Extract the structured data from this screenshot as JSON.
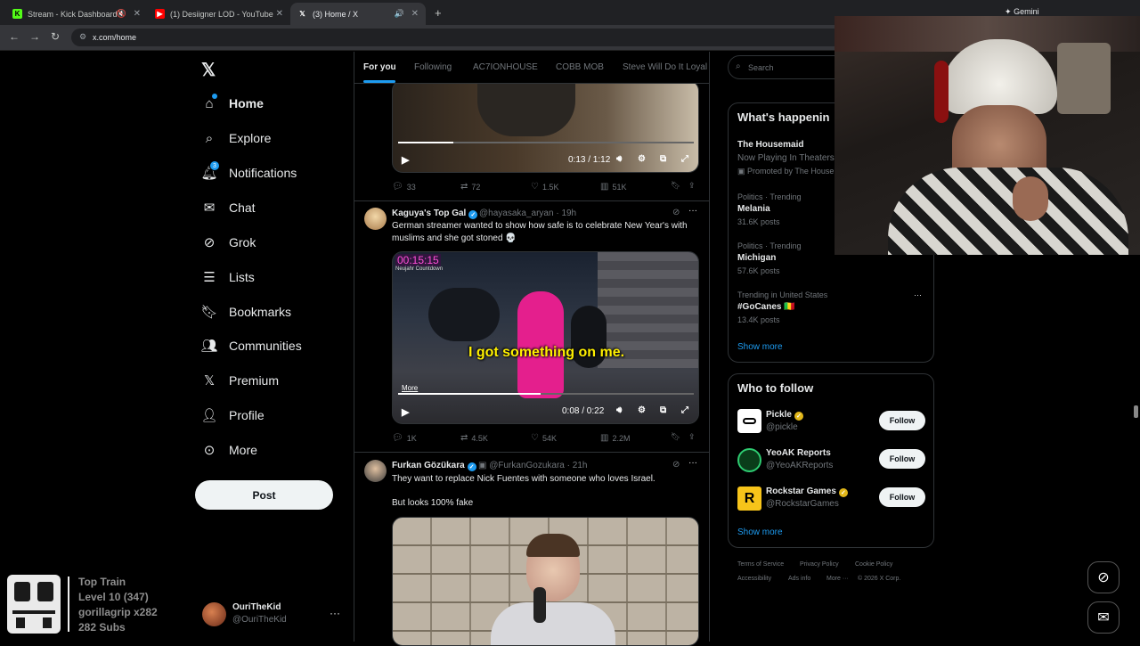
{
  "browser": {
    "tabs": [
      {
        "title": "Stream - Kick Dashboard",
        "icon": "kick-icon",
        "muted": true
      },
      {
        "title": "(1) Desiigner LOD - YouTube",
        "icon": "youtube-icon"
      },
      {
        "title": "(3) Home / X",
        "icon": "x-icon",
        "active": true
      }
    ],
    "gemini_label": "Gemini",
    "url": "x.com/home"
  },
  "nav": {
    "items": [
      {
        "label": "Home",
        "icon": "home-icon"
      },
      {
        "label": "Explore",
        "icon": "search-icon"
      },
      {
        "label": "Notifications",
        "icon": "bell-icon",
        "badge": "3"
      },
      {
        "label": "Chat",
        "icon": "mail-icon"
      },
      {
        "label": "Grok",
        "icon": "grok-icon"
      },
      {
        "label": "Lists",
        "icon": "list-icon"
      },
      {
        "label": "Bookmarks",
        "icon": "bookmark-icon"
      },
      {
        "label": "Communities",
        "icon": "people-icon"
      },
      {
        "label": "Premium",
        "icon": "x-icon"
      },
      {
        "label": "Profile",
        "icon": "person-icon"
      },
      {
        "label": "More",
        "icon": "more-circle-icon"
      }
    ],
    "post_label": "Post",
    "account": {
      "name": "OuriTheKid",
      "handle": "@OuriTheKid"
    }
  },
  "overlay": {
    "line1": "Top Train",
    "line2": "Level 10  (347)",
    "line3": "gorillagrip x282",
    "line4": "282 Subs"
  },
  "timeline": {
    "tabs": [
      "For you",
      "Following",
      "AC7IONHOUSE",
      "COBB MOB",
      "Steve Will Do It Loyal"
    ],
    "tweets": [
      {
        "video_time": "0:13 / 1:12",
        "stats": {
          "replies": "33",
          "reposts": "72",
          "likes": "1.5K",
          "views": "51K"
        }
      },
      {
        "name": "Kaguya's Top Gal",
        "handle": "@hayasaka_aryan",
        "time": "19h",
        "text": "German streamer wanted to show how safe is to celebrate New Year's with muslims and she got stoned 💀",
        "video_overlay_time": "00:15:15",
        "video_overlay_sub": "Neujahr Countdown",
        "caption": "I got something on me.",
        "more_label": "More",
        "video_time": "0:08 / 0:22",
        "stats": {
          "replies": "1K",
          "reposts": "4.5K",
          "likes": "54K",
          "views": "2.2M"
        }
      },
      {
        "name": "Furkan Gözükara",
        "handle": "@FurkanGozukara",
        "time": "21h",
        "text1": "They want to replace Nick Fuentes with someone who loves Israel.",
        "text2": "But looks 100% fake"
      }
    ]
  },
  "right": {
    "search_placeholder": "Search",
    "happening_title": "What's happenin",
    "promo": {
      "title": "The Housemaid",
      "sub": "Now Playing In Theaters",
      "promoted": "Promoted by The Housen"
    },
    "trends": [
      {
        "context": "Politics · Trending",
        "name": "Melania",
        "posts": "31.6K posts"
      },
      {
        "context": "Politics · Trending",
        "name": "Michigan",
        "posts": "57.6K posts"
      },
      {
        "context": "Trending in United States",
        "name": "#GoCanes 🇲🇱",
        "posts": "13.4K posts"
      }
    ],
    "show_more": "Show more",
    "who_to_follow_title": "Who to follow",
    "follow": [
      {
        "name": "Pickle",
        "handle": "@pickle",
        "verified": "gold"
      },
      {
        "name": "YeoAK Reports",
        "handle": "@YeoAKReports"
      },
      {
        "name": "Rockstar Games",
        "handle": "@RockstarGames",
        "verified": "gold"
      }
    ],
    "follow_label": "Follow",
    "footer": [
      "Terms of Service",
      "Privacy Policy",
      "Cookie Policy",
      "Accessibility",
      "Ads info",
      "More ···",
      "© 2026 X Corp."
    ]
  }
}
